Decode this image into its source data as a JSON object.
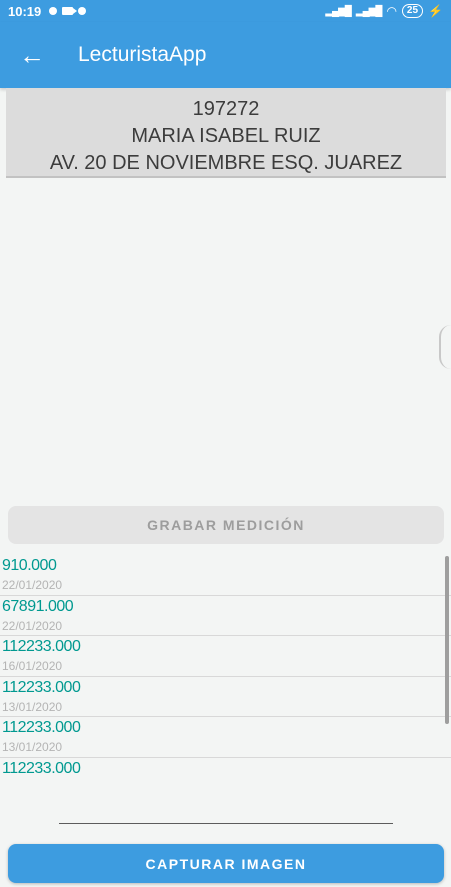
{
  "status_bar": {
    "time": "10:19",
    "battery": "25"
  },
  "app_bar": {
    "title": "LecturistaApp"
  },
  "customer": {
    "account": "197272",
    "name": "MARIA ISABEL RUIZ",
    "address": "AV. 20 DE NOVIEMBRE ESQ. JUAREZ"
  },
  "buttons": {
    "grabar": "GRABAR MEDICIÓN",
    "capturar": "CAPTURAR IMAGEN"
  },
  "readings": [
    {
      "value": "910.000",
      "date": "22/01/2020"
    },
    {
      "value": "67891.000",
      "date": "22/01/2020"
    },
    {
      "value": "112233.000",
      "date": "16/01/2020"
    },
    {
      "value": "112233.000",
      "date": "13/01/2020"
    },
    {
      "value": "112233.000",
      "date": "13/01/2020"
    },
    {
      "value": "112233.000",
      "date": ""
    }
  ],
  "colors": {
    "primary": "#3d9ce0",
    "reading_value": "#009990",
    "reading_date": "#b4b4b4"
  }
}
